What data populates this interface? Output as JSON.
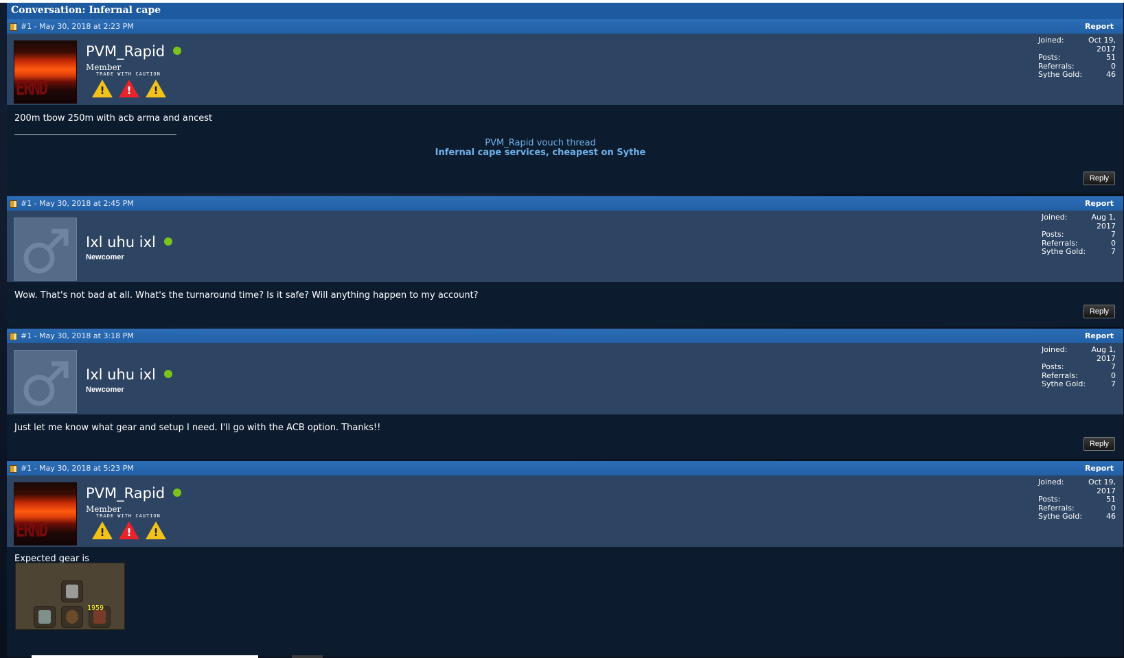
{
  "conversation": {
    "title": "Conversation: Infernal cape"
  },
  "posts": [
    {
      "header": "#1 - May 30, 2018 at 2:23 PM",
      "report": "Report",
      "username": "PVM_Rapid",
      "rank": "Member",
      "trade_caution": "TRADE WITH CAUTION",
      "stats": {
        "joined_label": "Joined:",
        "joined": "Oct 19, 2017",
        "posts_label": "Posts:",
        "posts": "51",
        "referrals_label": "Referrals:",
        "referrals": "0",
        "gold_label": "Sythe Gold:",
        "gold": "46"
      },
      "message": "200m tbow 250m with acb arma and ancest",
      "signature": {
        "line1": "PVM_Rapid vouch thread",
        "line2": "Infernal cape services, cheapest on Sythe"
      },
      "reply": "Reply"
    },
    {
      "header": "#1 - May 30, 2018 at 2:45 PM",
      "report": "Report",
      "username": "Ixl uhu ixl",
      "rank": "Newcomer",
      "stats": {
        "joined_label": "Joined:",
        "joined": "Aug 1, 2017",
        "posts_label": "Posts:",
        "posts": "7",
        "referrals_label": "Referrals:",
        "referrals": "0",
        "gold_label": "Sythe Gold:",
        "gold": "7"
      },
      "message": "Wow. That's not bad at all. What's the turnaround time? Is it safe? Will anything happen to my account?",
      "reply": "Reply"
    },
    {
      "header": "#1 - May 30, 2018 at 3:18 PM",
      "report": "Report",
      "username": "Ixl uhu ixl",
      "rank": "Newcomer",
      "stats": {
        "joined_label": "Joined:",
        "joined": "Aug 1, 2017",
        "posts_label": "Posts:",
        "posts": "7",
        "referrals_label": "Referrals:",
        "referrals": "0",
        "gold_label": "Sythe Gold:",
        "gold": "7"
      },
      "message": "Just let me know what gear and setup I need. I'll go with the ACB option. Thanks!!",
      "reply": "Reply"
    },
    {
      "header": "#1 - May 30, 2018 at 5:23 PM",
      "report": "Report",
      "username": "PVM_Rapid",
      "rank": "Member",
      "trade_caution": "TRADE WITH CAUTION",
      "stats": {
        "joined_label": "Joined:",
        "joined": "Oct 19, 2017",
        "posts_label": "Posts:",
        "posts": "51",
        "referrals_label": "Referrals:",
        "referrals": "0",
        "gold_label": "Sythe Gold:",
        "gold": "46"
      },
      "message": "Expected gear is",
      "gear_qty": "1959"
    }
  ],
  "colors": {
    "header_blue": "#2c6db5",
    "user_panel": "#2d4462",
    "body_panel": "#0c1b2e",
    "online_dot": "#7cc21c",
    "link": "#6fb2ea"
  },
  "avatar_caption": "ERND"
}
